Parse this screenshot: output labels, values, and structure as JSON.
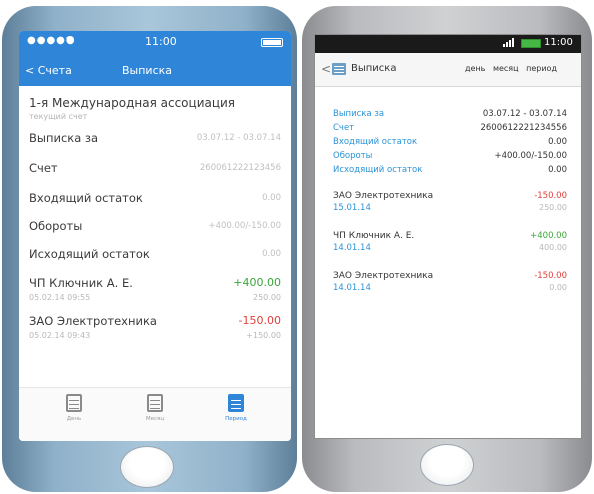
{
  "ios": {
    "status": {
      "signal": "●●●●● ",
      "wifi": "",
      "time": "11:00"
    },
    "nav": {
      "back": "< Счета",
      "title": "Выписка"
    },
    "account": {
      "name": "1-я Международная ассоциация",
      "type": "текущий счет"
    },
    "rows": [
      {
        "label": "Выписка за",
        "value": "03.07.12 - 03.07.14"
      },
      {
        "label": "Счет",
        "value": "260061222123456"
      },
      {
        "label": "Входящий остаток",
        "value": "0.00"
      },
      {
        "label": "Обороты",
        "value": "+400.00/-150.00"
      },
      {
        "label": "Исходящий остаток",
        "value": "0.00"
      }
    ],
    "transactions": [
      {
        "name": "ЧП Ключник А. Е.",
        "date": "05.02.14 09:55",
        "amount": "+400.00",
        "balance": "250.00",
        "color": "#3aa53a"
      },
      {
        "name": "ЗАО Электротехника",
        "date": "05.02.14 09:43",
        "amount": "-150.00",
        "balance": "+150.00",
        "color": "#e0403a"
      }
    ],
    "tabs": [
      {
        "label": "День",
        "icon": "calendar-day-icon"
      },
      {
        "label": "Месяц",
        "icon": "calendar-month-icon"
      },
      {
        "label": "Период",
        "icon": "calendar-period-icon"
      }
    ],
    "accent": "#2f86d8"
  },
  "android": {
    "status": {
      "time": "11:00"
    },
    "toolbar": {
      "back": "<",
      "title": "Выписка",
      "tabs": [
        "день",
        "месяц",
        "период"
      ]
    },
    "rows": [
      {
        "label": "Выписка за",
        "value": "03.07.12 - 03.07.14"
      },
      {
        "label": "Счет",
        "value": "2600612221234556"
      },
      {
        "label": "Входящий остаток",
        "value": "0.00"
      },
      {
        "label": "Обороты",
        "value": "+400.00/-150.00"
      },
      {
        "label": "Исходящий остаток",
        "value": "0.00"
      }
    ],
    "transactions": [
      {
        "name": "ЗАО Электротехника",
        "date": "15.01.14",
        "amount": "-150.00",
        "balance": "250.00",
        "color": "#e0403a"
      },
      {
        "name": "ЧП Ключник А. Е.",
        "date": "14.01.14",
        "amount": "+400.00",
        "balance": "400.00",
        "color": "#3aa53a"
      },
      {
        "name": "ЗАО Электротехника",
        "date": "14.01.14",
        "amount": "-150.00",
        "balance": "0.00",
        "color": "#e0403a"
      }
    ],
    "accent": "#2a93d8"
  }
}
